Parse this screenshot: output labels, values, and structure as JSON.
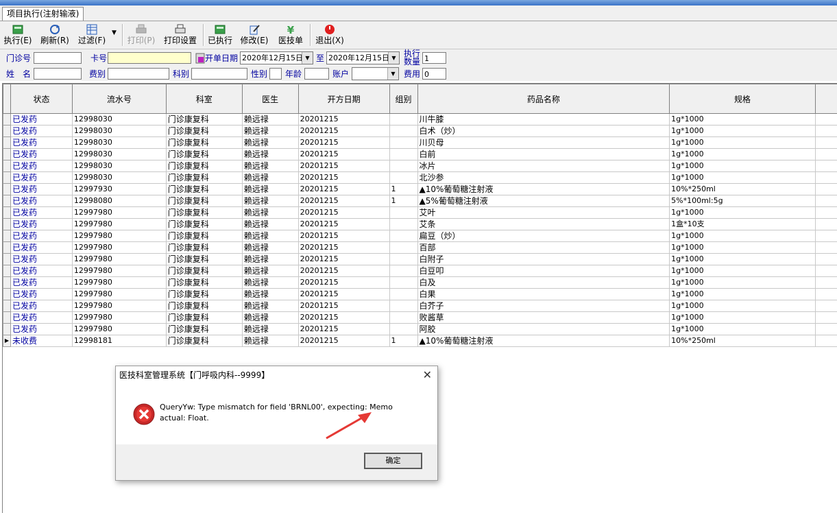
{
  "tab": {
    "label": "项目执行(注射输液)"
  },
  "toolbar": {
    "execute": "执行(E)",
    "refresh": "刷新(R)",
    "filter": "过滤(F)",
    "print": "打印(P)",
    "print_setup": "打印设置",
    "executed": "已执行",
    "modify": "修改(E)",
    "tech_order": "医技单",
    "exit": "退出(X)"
  },
  "filter": {
    "clinic_no_label": "门诊号",
    "card_no_label": "卡号",
    "order_date_label": "开单日期",
    "date_from": "2020年12月15日",
    "to_label": "至",
    "date_to": "2020年12月15日",
    "exec_qty_label_1": "执行",
    "exec_qty_label_2": "数量",
    "exec_qty_value": "1",
    "name_label": "姓　名",
    "fee_type_label": "费别",
    "dept_label": "科别",
    "gender_label": "性别",
    "age_label": "年龄",
    "account_label": "账户",
    "cost_label": "费用",
    "cost_value": "0"
  },
  "grid": {
    "columns": [
      "状态",
      "流水号",
      "科室",
      "医生",
      "开方日期",
      "组别",
      "药品名称",
      "规格"
    ],
    "rows": [
      {
        "status": "已发药",
        "serial": "12998030",
        "dept": "门诊康复科",
        "doctor": "赖远禄",
        "date": "20201215",
        "group": "",
        "drug": "川牛膝",
        "spec": "1g*1000"
      },
      {
        "status": "已发药",
        "serial": "12998030",
        "dept": "门诊康复科",
        "doctor": "赖远禄",
        "date": "20201215",
        "group": "",
        "drug": "白术（炒）",
        "spec": "1g*1000"
      },
      {
        "status": "已发药",
        "serial": "12998030",
        "dept": "门诊康复科",
        "doctor": "赖远禄",
        "date": "20201215",
        "group": "",
        "drug": "川贝母",
        "spec": "1g*1000"
      },
      {
        "status": "已发药",
        "serial": "12998030",
        "dept": "门诊康复科",
        "doctor": "赖远禄",
        "date": "20201215",
        "group": "",
        "drug": "白前",
        "spec": "1g*1000"
      },
      {
        "status": "已发药",
        "serial": "12998030",
        "dept": "门诊康复科",
        "doctor": "赖远禄",
        "date": "20201215",
        "group": "",
        "drug": "冰片",
        "spec": "1g*1000"
      },
      {
        "status": "已发药",
        "serial": "12998030",
        "dept": "门诊康复科",
        "doctor": "赖远禄",
        "date": "20201215",
        "group": "",
        "drug": "北沙参",
        "spec": "1g*1000"
      },
      {
        "status": "已发药",
        "serial": "12997930",
        "dept": "门诊康复科",
        "doctor": "赖远禄",
        "date": "20201215",
        "group": "1",
        "drug": "▲10%葡萄糖注射液",
        "spec": "10%*250ml"
      },
      {
        "status": "已发药",
        "serial": "12998080",
        "dept": "门诊康复科",
        "doctor": "赖远禄",
        "date": "20201215",
        "group": "1",
        "drug": "▲5%葡萄糖注射液",
        "spec": "5%*100ml:5g"
      },
      {
        "status": "已发药",
        "serial": "12997980",
        "dept": "门诊康复科",
        "doctor": "赖远禄",
        "date": "20201215",
        "group": "",
        "drug": "艾叶",
        "spec": "1g*1000"
      },
      {
        "status": "已发药",
        "serial": "12997980",
        "dept": "门诊康复科",
        "doctor": "赖远禄",
        "date": "20201215",
        "group": "",
        "drug": "艾条",
        "spec": "1盒*10支"
      },
      {
        "status": "已发药",
        "serial": "12997980",
        "dept": "门诊康复科",
        "doctor": "赖远禄",
        "date": "20201215",
        "group": "",
        "drug": "扁豆（炒）",
        "spec": "1g*1000"
      },
      {
        "status": "已发药",
        "serial": "12997980",
        "dept": "门诊康复科",
        "doctor": "赖远禄",
        "date": "20201215",
        "group": "",
        "drug": "百部",
        "spec": "1g*1000"
      },
      {
        "status": "已发药",
        "serial": "12997980",
        "dept": "门诊康复科",
        "doctor": "赖远禄",
        "date": "20201215",
        "group": "",
        "drug": "白附子",
        "spec": "1g*1000"
      },
      {
        "status": "已发药",
        "serial": "12997980",
        "dept": "门诊康复科",
        "doctor": "赖远禄",
        "date": "20201215",
        "group": "",
        "drug": "白豆叩",
        "spec": "1g*1000"
      },
      {
        "status": "已发药",
        "serial": "12997980",
        "dept": "门诊康复科",
        "doctor": "赖远禄",
        "date": "20201215",
        "group": "",
        "drug": "白及",
        "spec": "1g*1000"
      },
      {
        "status": "已发药",
        "serial": "12997980",
        "dept": "门诊康复科",
        "doctor": "赖远禄",
        "date": "20201215",
        "group": "",
        "drug": "白果",
        "spec": "1g*1000"
      },
      {
        "status": "已发药",
        "serial": "12997980",
        "dept": "门诊康复科",
        "doctor": "赖远禄",
        "date": "20201215",
        "group": "",
        "drug": "白芥子",
        "spec": "1g*1000"
      },
      {
        "status": "已发药",
        "serial": "12997980",
        "dept": "门诊康复科",
        "doctor": "赖远禄",
        "date": "20201215",
        "group": "",
        "drug": "败酱草",
        "spec": "1g*1000"
      },
      {
        "status": "已发药",
        "serial": "12997980",
        "dept": "门诊康复科",
        "doctor": "赖远禄",
        "date": "20201215",
        "group": "",
        "drug": "阿胶",
        "spec": "1g*1000"
      },
      {
        "status": "未收费",
        "serial": "12998181",
        "dept": "门诊康复科",
        "doctor": "赖远禄",
        "date": "20201215",
        "group": "1",
        "drug": "▲10%葡萄糖注射液",
        "spec": "10%*250ml"
      }
    ]
  },
  "dialog": {
    "title": "医技科室管理系统【门呼吸内科--9999】",
    "message": "QueryYw: Type mismatch for field 'BRNL00', expecting: Memo actual: Float.",
    "ok_label": "确定"
  }
}
